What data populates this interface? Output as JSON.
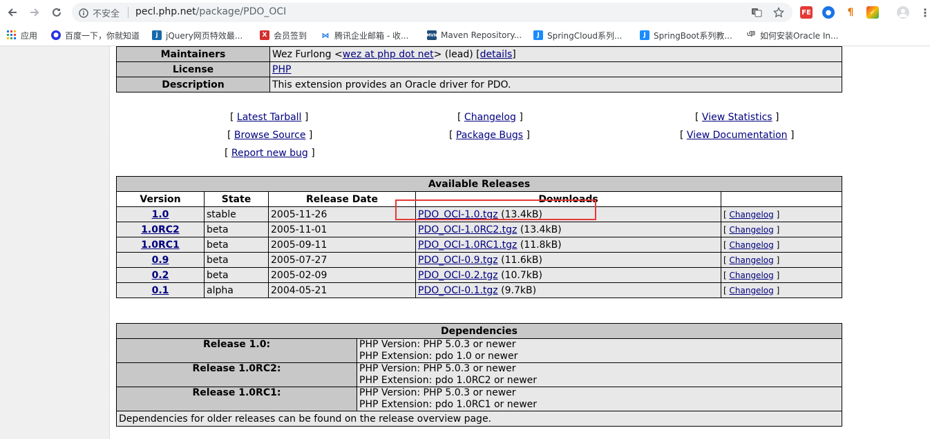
{
  "browser": {
    "security_label": "不安全",
    "url_host": "pecl.php.net",
    "url_path": "/package/PDO_OCI"
  },
  "bookmarks": [
    {
      "label": "应用",
      "icon": "apps-grid-icon"
    },
    {
      "label": "百度一下，你就知道",
      "icon": "baidu-paw-icon"
    },
    {
      "label": "jQuery网页特效最...",
      "icon": "jquery-icon"
    },
    {
      "label": "会员签到",
      "icon": "signin-icon"
    },
    {
      "label": "腾讯企业邮箱 - 收...",
      "icon": "tencent-mail-icon"
    },
    {
      "label": "Maven Repository...",
      "icon": "maven-icon"
    },
    {
      "label": "SpringCloud系列...",
      "icon": "jianshu-icon"
    },
    {
      "label": "SpringBoot系列教...",
      "icon": "jianshu-icon"
    },
    {
      "label": "如何安装Oracle In...",
      "icon": "oracle-icon"
    }
  ],
  "info": {
    "maintainers_label": "Maintainers",
    "maintainer_name": "Wez Furlong <",
    "maintainer_email": "wez at php dot net",
    "maintainer_role": "> (lead) [",
    "details_link": "details",
    "maintainer_end": "]",
    "license_label": "License",
    "license_value": "PHP",
    "description_label": "Description",
    "description_value": "This extension provides an Oracle driver for PDO."
  },
  "links": {
    "latest_tarball": "Latest Tarball",
    "changelog": "Changelog",
    "view_statistics": "View Statistics",
    "browse_source": "Browse Source",
    "package_bugs": "Package Bugs",
    "view_documentation": "View Documentation",
    "report_new_bug": "Report new bug"
  },
  "releases": {
    "title": "Available Releases",
    "headers": [
      "Version",
      "State",
      "Release Date",
      "Downloads",
      ""
    ],
    "changelog_label": "Changelog",
    "rows": [
      {
        "version": "1.0",
        "state": "stable",
        "date": "2005-11-26",
        "file": "PDO_OCI-1.0.tgz",
        "size": "(13.4kB)"
      },
      {
        "version": "1.0RC2",
        "state": "beta",
        "date": "2005-11-01",
        "file": "PDO_OCI-1.0RC2.tgz",
        "size": "(13.4kB)"
      },
      {
        "version": "1.0RC1",
        "state": "beta",
        "date": "2005-09-11",
        "file": "PDO_OCI-1.0RC1.tgz",
        "size": "(11.8kB)"
      },
      {
        "version": "0.9",
        "state": "beta",
        "date": "2005-07-27",
        "file": "PDO_OCI-0.9.tgz",
        "size": "(11.6kB)"
      },
      {
        "version": "0.2",
        "state": "beta",
        "date": "2005-02-09",
        "file": "PDO_OCI-0.2.tgz",
        "size": "(10.7kB)"
      },
      {
        "version": "0.1",
        "state": "alpha",
        "date": "2004-05-21",
        "file": "PDO_OCI-0.1.tgz",
        "size": "(9.7kB)"
      }
    ]
  },
  "dependencies": {
    "title": "Dependencies",
    "rows": [
      {
        "release": "Release 1.0:",
        "php": "PHP Version: PHP 5.0.3 or newer",
        "ext": "PHP Extension: pdo 1.0 or newer"
      },
      {
        "release": "Release 1.0RC2:",
        "php": "PHP Version: PHP 5.0.3 or newer",
        "ext": "PHP Extension: pdo 1.0RC2 or newer"
      },
      {
        "release": "Release 1.0RC1:",
        "php": "PHP Version: PHP 5.0.3 or newer",
        "ext": "PHP Extension: pdo 1.0RC1 or newer"
      }
    ],
    "note": "Dependencies for older releases can be found on the release overview page."
  },
  "colors": {
    "header_cell": "#c8c8c8",
    "value_cell": "#e8e8e8",
    "link": "#000080",
    "highlight_box": "#e53935"
  }
}
